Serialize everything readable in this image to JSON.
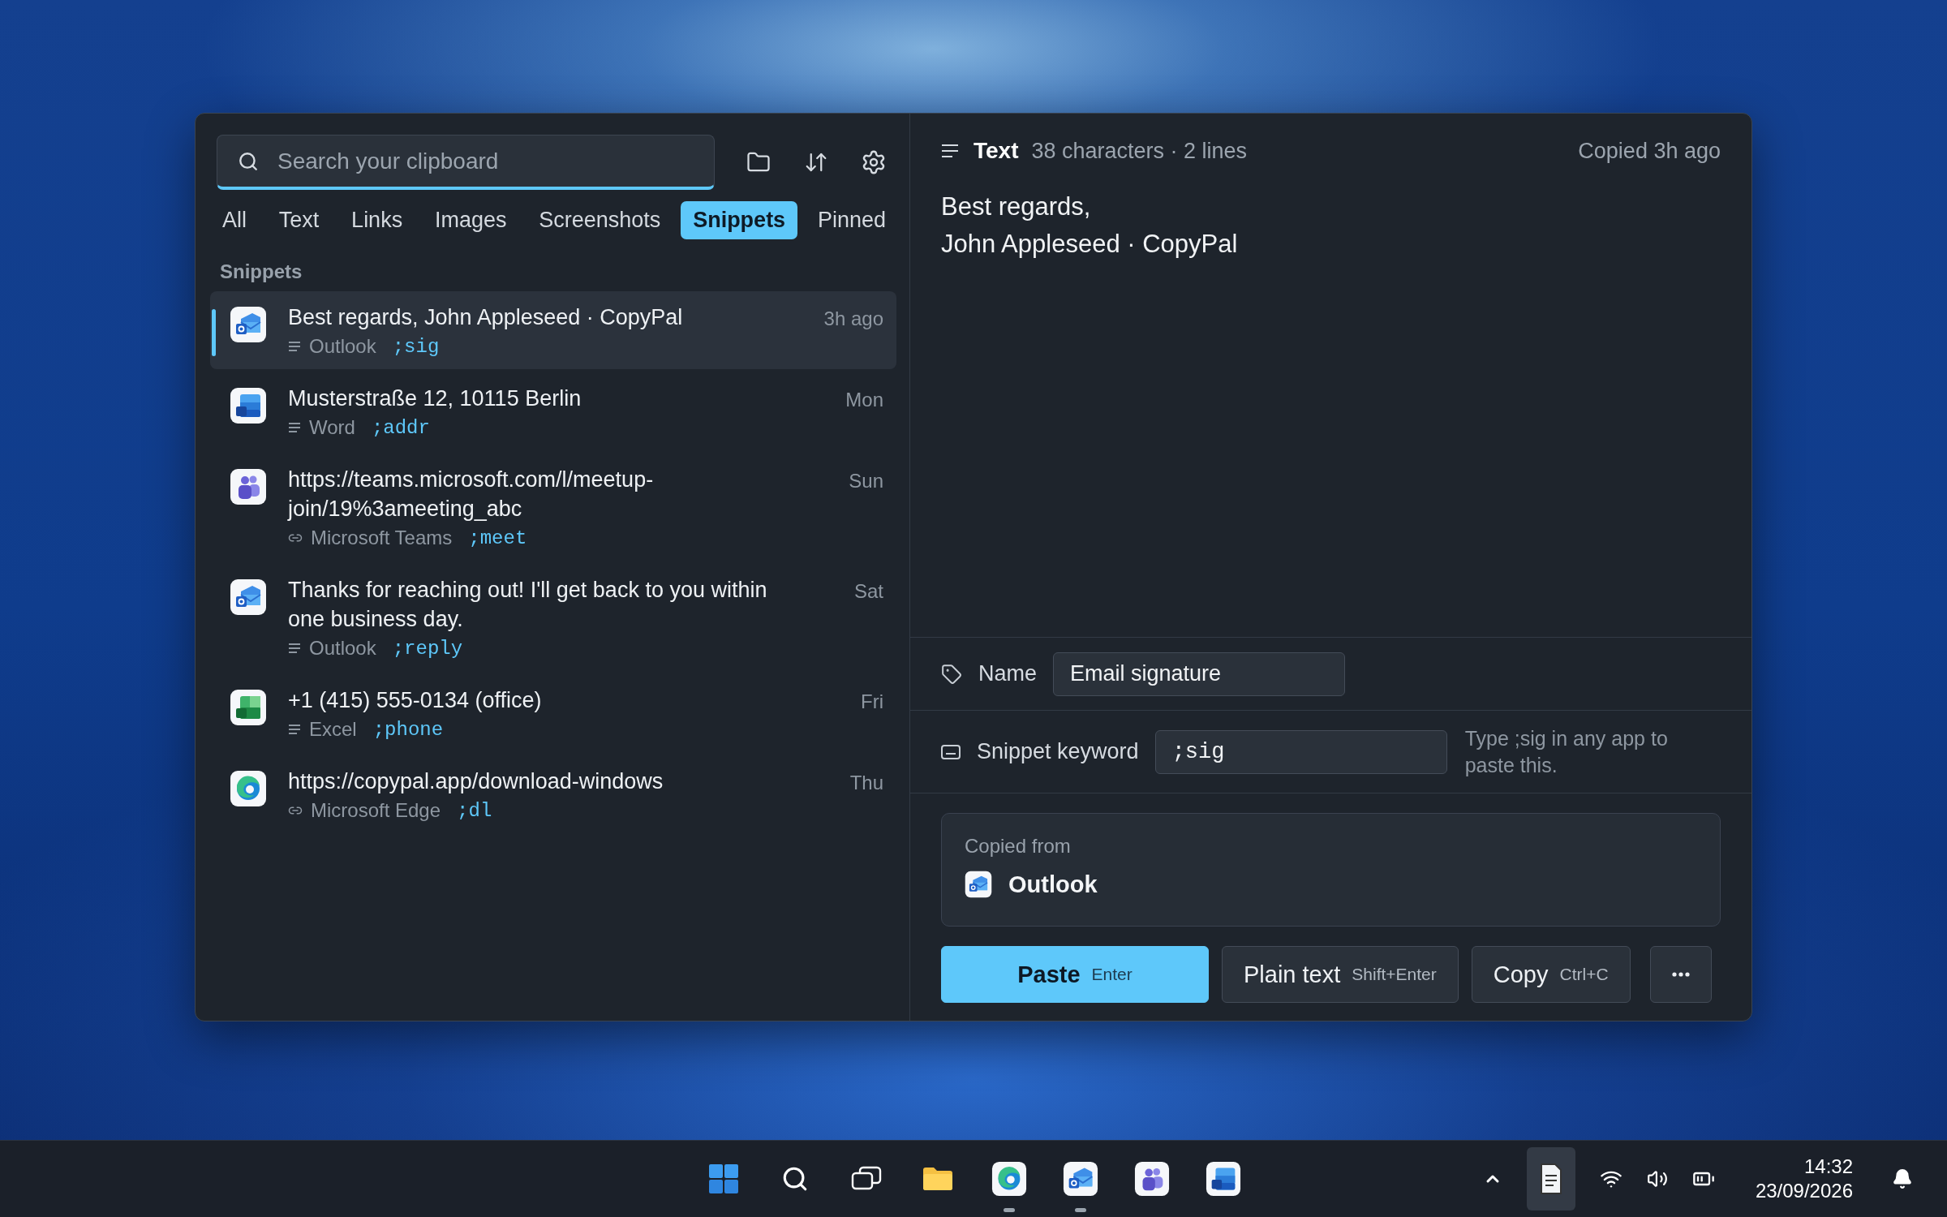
{
  "search": {
    "placeholder": "Search your clipboard"
  },
  "tabs": [
    {
      "label": "All",
      "selected": false
    },
    {
      "label": "Text",
      "selected": false
    },
    {
      "label": "Links",
      "selected": false
    },
    {
      "label": "Images",
      "selected": false
    },
    {
      "label": "Screenshots",
      "selected": false
    },
    {
      "label": "Snippets",
      "selected": true
    },
    {
      "label": "Pinned",
      "selected": false
    }
  ],
  "section_title": "Snippets",
  "items": [
    {
      "title": "Best regards, John Appleseed · CopyPal",
      "source": {
        "name": "Outlook",
        "kind": "outlook"
      },
      "kind": "text",
      "keyword": ";sig",
      "time": "3h ago",
      "selected": true
    },
    {
      "title": "Musterstraße 12, 10115 Berlin",
      "source": {
        "name": "Word",
        "kind": "word"
      },
      "kind": "text",
      "keyword": ";addr",
      "time": "Mon",
      "selected": false
    },
    {
      "title": "https://teams.microsoft.com/l/meetup-join/19%3ameeting_abc",
      "source": {
        "name": "Microsoft Teams",
        "kind": "teams"
      },
      "kind": "link",
      "keyword": ";meet",
      "time": "Sun",
      "selected": false
    },
    {
      "title": "Thanks for reaching out! I'll get back to you within one business day.",
      "source": {
        "name": "Outlook",
        "kind": "outlook"
      },
      "kind": "text",
      "keyword": ";reply",
      "time": "Sat",
      "selected": false
    },
    {
      "title": "+1 (415) 555-0134 (office)",
      "source": {
        "name": "Excel",
        "kind": "excel"
      },
      "kind": "text",
      "keyword": ";phone",
      "time": "Fri",
      "selected": false
    },
    {
      "title": "https://copypal.app/download-windows",
      "source": {
        "name": "Microsoft Edge",
        "kind": "edge"
      },
      "kind": "link",
      "keyword": ";dl",
      "time": "Thu",
      "selected": false
    }
  ],
  "detail": {
    "type_label": "Text",
    "stats": "38 characters · 2 lines",
    "copied": "Copied 3h ago",
    "content_lines": [
      "Best regards,",
      "John Appleseed · CopyPal"
    ],
    "name_label": "Name",
    "name_value": "Email signature",
    "keyword_label": "Snippet keyword",
    "keyword_value": ";sig",
    "keyword_hint": "Type ;sig in any app to paste this.",
    "source_label": "Copied from",
    "source": {
      "name": "Outlook",
      "kind": "outlook"
    }
  },
  "actions": [
    {
      "kind": "primary",
      "label": "Paste",
      "shortcut": "Enter"
    },
    {
      "kind": "secondary",
      "label": "Plain text",
      "shortcut": "Shift+Enter"
    },
    {
      "kind": "secondary",
      "label": "Copy",
      "shortcut": "Ctrl+C"
    },
    {
      "kind": "more"
    }
  ],
  "taskbar": {
    "apps": [
      {
        "kind": "start",
        "running": false
      },
      {
        "kind": "search",
        "running": false
      },
      {
        "kind": "taskview",
        "running": false
      },
      {
        "kind": "files",
        "running": false
      },
      {
        "kind": "edge",
        "running": true
      },
      {
        "kind": "outlook",
        "running": true
      },
      {
        "kind": "teams",
        "running": false
      },
      {
        "kind": "word",
        "running": false
      }
    ],
    "time": "14:32",
    "date": "23/09/2026"
  }
}
